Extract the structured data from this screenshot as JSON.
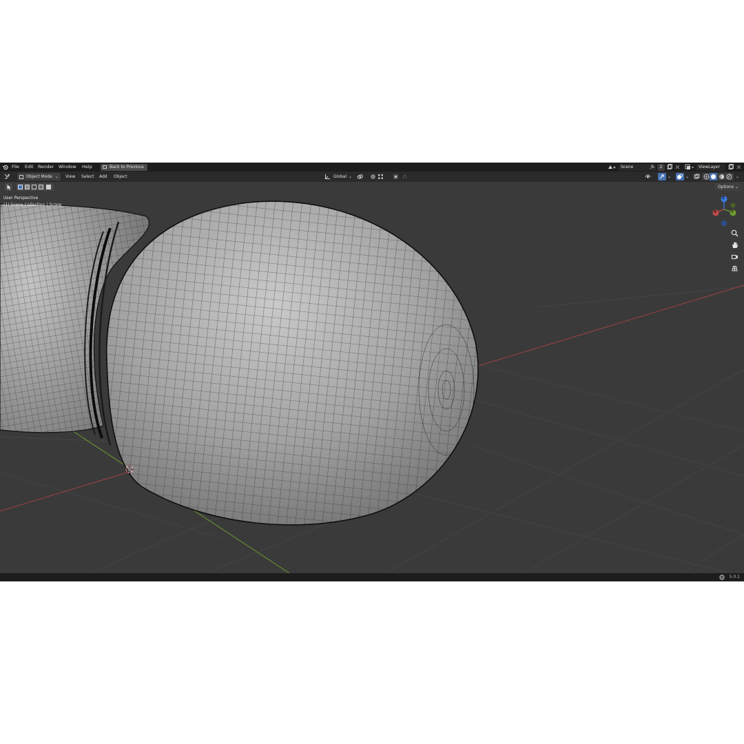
{
  "menubar": {
    "items": [
      "File",
      "Edit",
      "Render",
      "Window",
      "Help"
    ],
    "back_button": "Back to Previous",
    "scene_name": "Scene",
    "scene_count": "2",
    "view_layer": "ViewLayer"
  },
  "header": {
    "mode": "Object Mode",
    "menus": [
      "View",
      "Select",
      "Add",
      "Object"
    ],
    "transform_orientation": "Global"
  },
  "tools": {
    "options_label": "Options"
  },
  "viewport": {
    "view_name": "User Perspective",
    "collection_info": "(1) Scene Collection | Scoop"
  },
  "gizmo": {
    "z_label": "Z",
    "x_label": "X",
    "y_label": "Y"
  },
  "status": {
    "version": "5.0.1"
  },
  "colors": {
    "x_axis": "#c04a4a",
    "y_axis": "#6f9b2e",
    "z_axis": "#3b7be0",
    "accent": "#4772b3"
  },
  "icons": [
    "blender-logo-icon",
    "editor-type-icon",
    "object-mode-icon",
    "transform-orientation-icon",
    "pivot-icon",
    "snap-icon",
    "proportional-edit-icon",
    "visibility-icon",
    "gizmo-icon",
    "overlay-icon",
    "xray-icon",
    "shading-wireframe-icon",
    "shading-solid-icon",
    "shading-material-icon",
    "shading-rendered-icon",
    "zoom-icon",
    "pan-hand-icon",
    "camera-icon",
    "grid-view-icon",
    "globe-icon"
  ]
}
